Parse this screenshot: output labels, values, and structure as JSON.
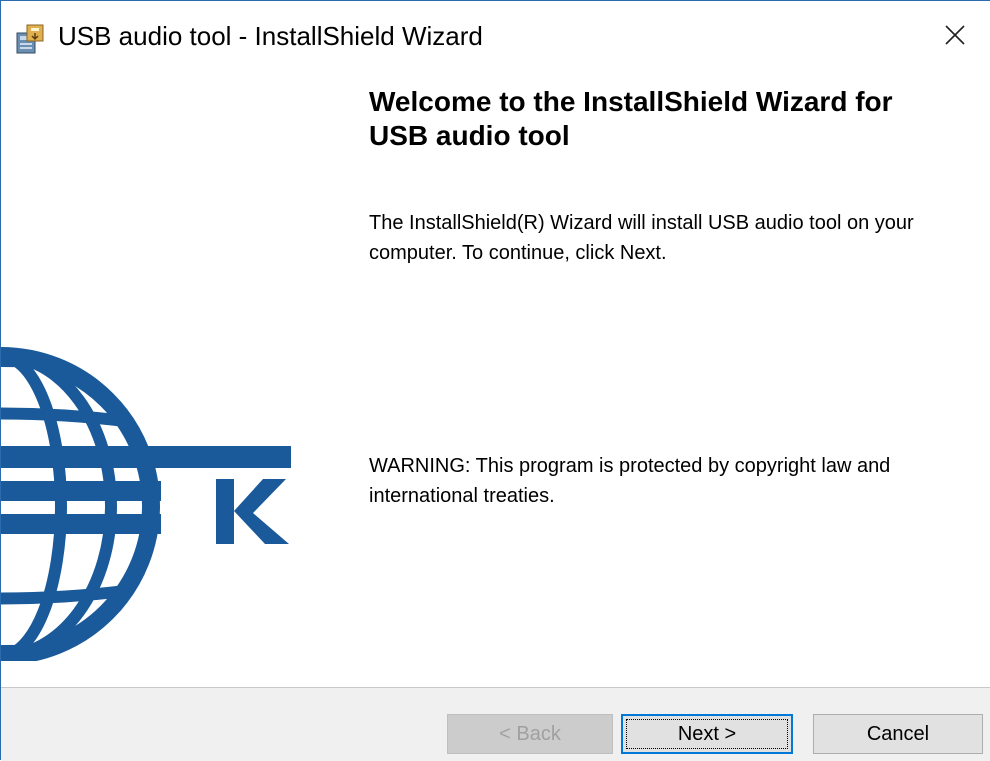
{
  "window": {
    "title": "USB audio tool - InstallShield Wizard",
    "icon": "installer-icon",
    "close_icon": "close-icon"
  },
  "content": {
    "welcome_title": "Welcome to the InstallShield Wizard for USB audio tool",
    "intro": "The InstallShield(R) Wizard will install USB audio tool on your computer. To continue, click Next.",
    "warning": "WARNING: This program is protected by copyright law and international treaties."
  },
  "side_art": {
    "icon": "globe-logo",
    "letter": "K",
    "color": "#1a5a9a"
  },
  "buttons": {
    "back": "< Back",
    "next": "Next >",
    "cancel": "Cancel"
  }
}
